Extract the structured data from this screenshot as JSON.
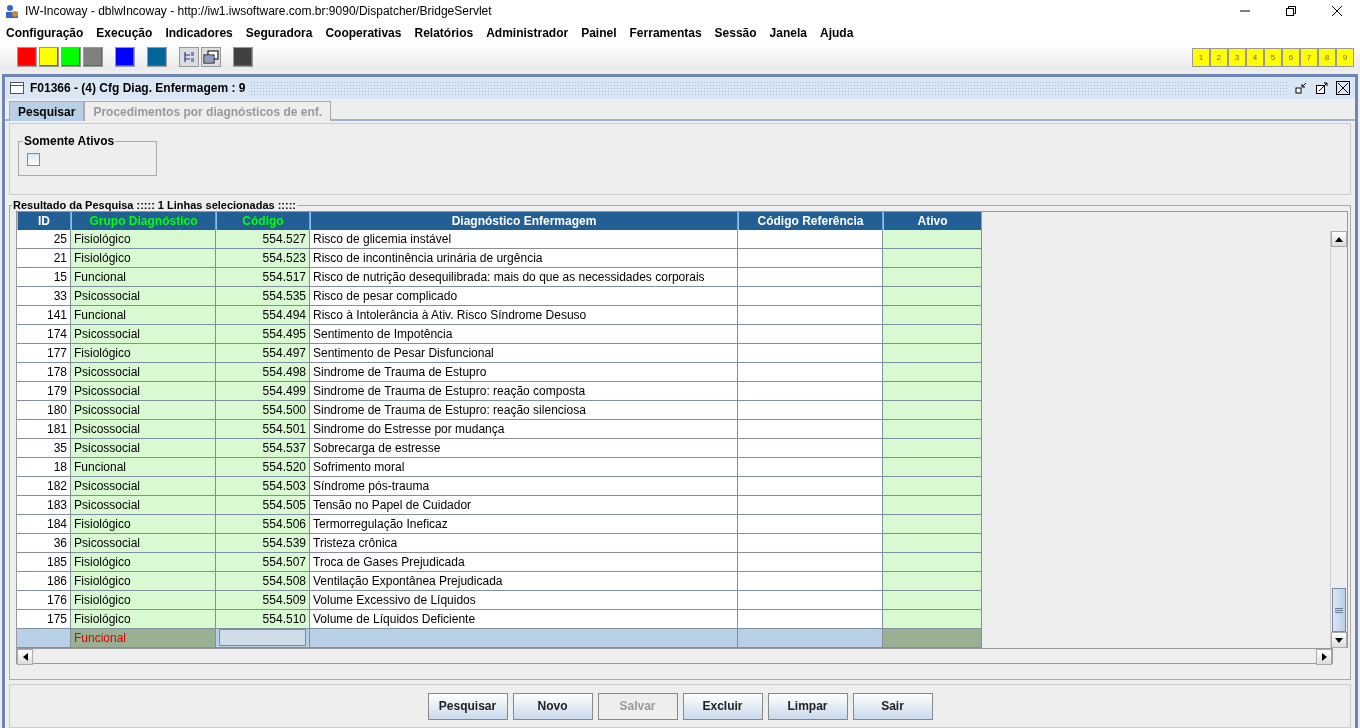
{
  "window": {
    "title": "IW-Incoway - dblwIncoway - http://iw1.iwsoftware.com.br:9090/Dispatcher/BridgeServlet"
  },
  "menu": [
    "Configuração",
    "Execução",
    "Indicadores",
    "Seguradora",
    "Cooperativas",
    "Relatórios",
    "Administrador",
    "Painel",
    "Ferramentas",
    "Sessão",
    "Janela",
    "Ajuda"
  ],
  "toolbar": [
    {
      "kind": "swatch",
      "color": "#ff0000"
    },
    {
      "kind": "swatch",
      "color": "#ffff00"
    },
    {
      "kind": "swatch",
      "color": "#00ff00"
    },
    {
      "kind": "swatch",
      "color": "#808080"
    },
    {
      "kind": "swatch",
      "color": "#0000ff"
    },
    {
      "kind": "swatch",
      "color": "#006699"
    },
    {
      "kind": "tree"
    },
    {
      "kind": "windows"
    },
    {
      "kind": "swatch",
      "color": "#404040"
    }
  ],
  "window_buttons": [
    "1",
    "2",
    "3",
    "4",
    "5",
    "6",
    "7",
    "8",
    "9"
  ],
  "frame": {
    "title": "F01366 - (4) Cfg Diag. Enfermagem : 9"
  },
  "tabs": [
    {
      "label": "Pesquisar",
      "selected": true
    },
    {
      "label": "Procedimentos por diagnósticos de enf.",
      "selected": false
    }
  ],
  "filter": {
    "title": "Somente Ativos",
    "checked": false
  },
  "results": {
    "title": "Resultado da Pesquisa ::::: 1 Linhas selecionadas :::::",
    "columns": [
      {
        "label": "ID",
        "highlighted": false
      },
      {
        "label": "Grupo Diagnóstico",
        "highlighted": true
      },
      {
        "label": "Código",
        "highlighted": true
      },
      {
        "label": "Diagnóstico Enfermagem",
        "highlighted": false
      },
      {
        "label": "Código Referência",
        "highlighted": false
      },
      {
        "label": "Ativo",
        "highlighted": false
      }
    ],
    "rows": [
      {
        "id": "25",
        "group": "Fisiológico",
        "code": "554.527",
        "diagnosis": "Risco de glicemia instável",
        "selected": false
      },
      {
        "id": "21",
        "group": "Fisiológico",
        "code": "554.523",
        "diagnosis": "Risco de incontinência urinária de urgência",
        "selected": false
      },
      {
        "id": "15",
        "group": "Funcional",
        "code": "554.517",
        "diagnosis": "Risco de nutrição desequilibrada: mais do que as necessidades corporais",
        "selected": false
      },
      {
        "id": "33",
        "group": "Psicossocial",
        "code": "554.535",
        "diagnosis": "Risco de pesar complicado",
        "selected": false
      },
      {
        "id": "141",
        "group": "Funcional",
        "code": "554.494",
        "diagnosis": "Risco à Intolerância à Ativ. Risco Síndrome Desuso",
        "selected": false
      },
      {
        "id": "174",
        "group": "Psicossocial",
        "code": "554.495",
        "diagnosis": "Sentimento de Impotência",
        "selected": false
      },
      {
        "id": "177",
        "group": "Fisiológico",
        "code": "554.497",
        "diagnosis": "Sentimento de Pesar Disfuncional",
        "selected": false
      },
      {
        "id": "178",
        "group": "Psicossocial",
        "code": "554.498",
        "diagnosis": "Sindrome de Trauma de Estupro",
        "selected": false
      },
      {
        "id": "179",
        "group": "Psicossocial",
        "code": "554.499",
        "diagnosis": "Sindrome de Trauma de Estupro: reação composta",
        "selected": false
      },
      {
        "id": "180",
        "group": "Psicossocial",
        "code": "554.500",
        "diagnosis": "Sindrome de Trauma de Estupro: reação silenciosa",
        "selected": false
      },
      {
        "id": "181",
        "group": "Psicossocial",
        "code": "554.501",
        "diagnosis": "Sindrome do Estresse por mudança",
        "selected": false
      },
      {
        "id": "35",
        "group": "Psicossocial",
        "code": "554.537",
        "diagnosis": "Sobrecarga de estresse",
        "selected": false
      },
      {
        "id": "18",
        "group": "Funcional",
        "code": "554.520",
        "diagnosis": "Sofrimento moral",
        "selected": false
      },
      {
        "id": "182",
        "group": "Psicossocial",
        "code": "554.503",
        "diagnosis": "Síndrome pós-trauma",
        "selected": false
      },
      {
        "id": "183",
        "group": "Psicossocial",
        "code": "554.505",
        "diagnosis": "Tensão no Papel de Cuidador",
        "selected": false
      },
      {
        "id": "184",
        "group": "Fisiológico",
        "code": "554.506",
        "diagnosis": "Termorregulação Ineficaz",
        "selected": false
      },
      {
        "id": "36",
        "group": "Psicossocial",
        "code": "554.539",
        "diagnosis": "Tristeza crônica",
        "selected": false
      },
      {
        "id": "185",
        "group": "Fisiológico",
        "code": "554.507",
        "diagnosis": "Troca de Gases Prejudicada",
        "selected": false
      },
      {
        "id": "186",
        "group": "Fisiológico",
        "code": "554.508",
        "diagnosis": "Ventilação Expontânea Prejudicada",
        "selected": false
      },
      {
        "id": "176",
        "group": "Fisiológico",
        "code": "554.509",
        "diagnosis": "Volume Excessivo de Líquidos",
        "selected": false
      },
      {
        "id": "175",
        "group": "Fisiológico",
        "code": "554.510",
        "diagnosis": "Volume de Líquidos Deficiente",
        "selected": false
      },
      {
        "group": "Funcional",
        "selected": true
      }
    ]
  },
  "buttons": [
    {
      "label": "Pesquisar",
      "disabled": false
    },
    {
      "label": "Novo",
      "disabled": false
    },
    {
      "label": "Salvar",
      "disabled": true
    },
    {
      "label": "Excluir",
      "disabled": false
    },
    {
      "label": "Limpar",
      "disabled": false
    },
    {
      "label": "Sair",
      "disabled": false
    }
  ]
}
